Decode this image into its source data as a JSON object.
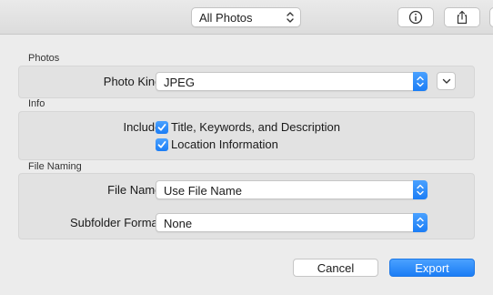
{
  "toolbar": {
    "album_select": "All Photos",
    "info_button": "info-icon",
    "share_button": "share-icon"
  },
  "photos_section": {
    "title": "Photos",
    "photo_kind_label": "Photo Kind:",
    "photo_kind_value": "JPEG"
  },
  "info_section": {
    "title": "Info",
    "include_label": "Include:",
    "options": [
      {
        "label": "Title, Keywords, and Description",
        "checked": true
      },
      {
        "label": "Location Information",
        "checked": true
      }
    ]
  },
  "file_naming_section": {
    "title": "File Naming",
    "file_name_label": "File Name:",
    "file_name_value": "Use File Name",
    "subfolder_label": "Subfolder Format:",
    "subfolder_value": "None"
  },
  "actions": {
    "cancel": "Cancel",
    "export": "Export"
  },
  "colors": {
    "accent": "#1b7df5",
    "window_bg": "#ececec",
    "group_bg": "#e2e2e2"
  }
}
